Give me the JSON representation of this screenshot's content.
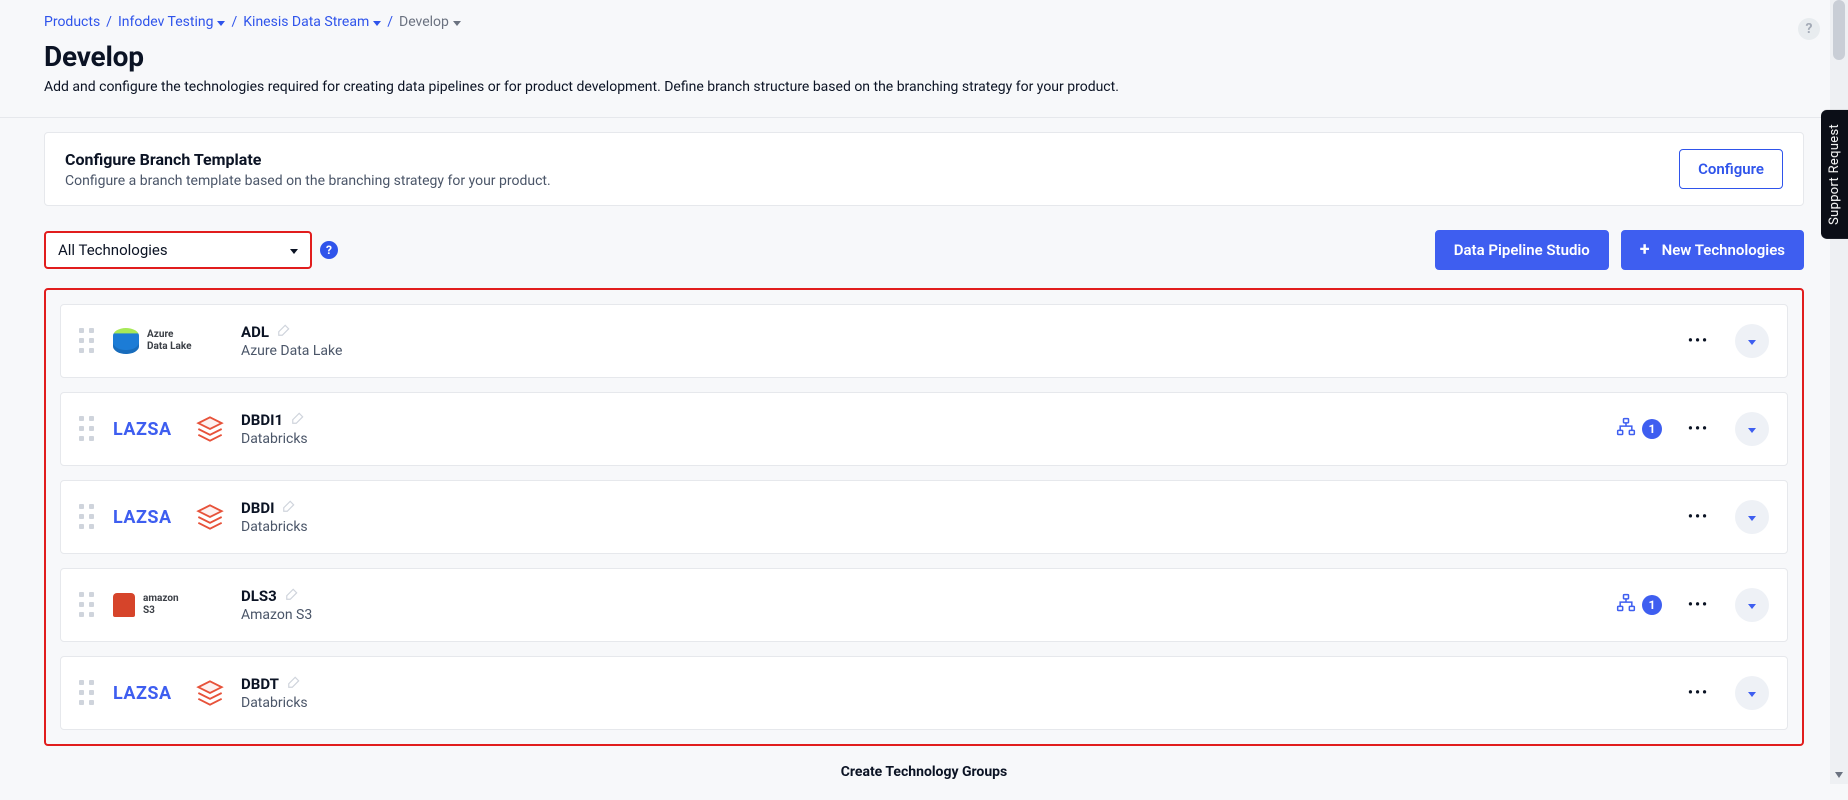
{
  "breadcrumb": {
    "items": [
      {
        "label": "Products",
        "type": "link"
      },
      {
        "label": "Infodev Testing",
        "type": "dropdown"
      },
      {
        "label": "Kinesis Data Stream",
        "type": "dropdown"
      },
      {
        "label": "Develop",
        "type": "current-dropdown"
      }
    ],
    "sep": "/"
  },
  "header": {
    "title": "Develop",
    "subtitle": "Add and configure the technologies required for creating data pipelines or for product development. Define branch structure based on the branching strategy for your product.",
    "help_glyph": "?"
  },
  "branch_card": {
    "title": "Configure Branch Template",
    "subtitle": "Configure a branch template based on the branching strategy for your product.",
    "button": "Configure"
  },
  "toolbar": {
    "filter_label": "All Technologies",
    "help_glyph": "?",
    "pipeline_button": "Data Pipeline Studio",
    "new_tech_button": "New Technologies"
  },
  "technologies": [
    {
      "logo": "adl",
      "name": "ADL",
      "subtitle": "Azure Data Lake",
      "badge": null
    },
    {
      "logo": "lazsa",
      "name": "DBDI1",
      "subtitle": "Databricks",
      "badge": 1
    },
    {
      "logo": "lazsa",
      "name": "DBDI",
      "subtitle": "Databricks",
      "badge": null
    },
    {
      "logo": "amazon-s3",
      "name": "DLS3",
      "subtitle": "Amazon S3",
      "badge": 1
    },
    {
      "logo": "lazsa",
      "name": "DBDT",
      "subtitle": "Databricks",
      "badge": null
    }
  ],
  "adl_logo_text": {
    "line1": "Azure",
    "line2": "Data Lake"
  },
  "amazon_logo_text": {
    "line1": "amazon",
    "line2": "S3"
  },
  "lazsa_text": "LAZSA",
  "bottom_link": "Create Technology Groups",
  "support_tab": "Support Request",
  "colors": {
    "accent": "#3e5ef0",
    "highlight_border": "#e11d1d"
  }
}
